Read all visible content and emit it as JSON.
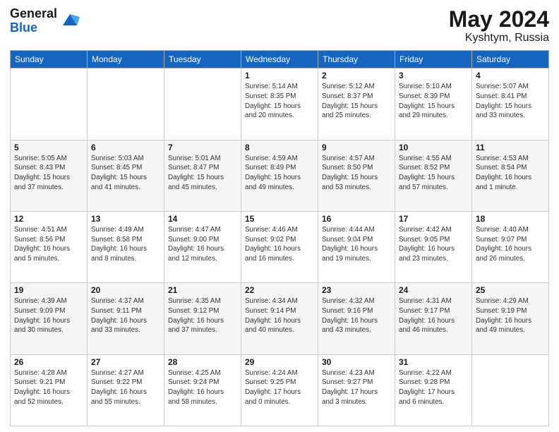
{
  "header": {
    "logo_general": "General",
    "logo_blue": "Blue",
    "title": "May 2024",
    "location": "Kyshtym, Russia"
  },
  "weekdays": [
    "Sunday",
    "Monday",
    "Tuesday",
    "Wednesday",
    "Thursday",
    "Friday",
    "Saturday"
  ],
  "weeks": [
    [
      {
        "day": "",
        "info": ""
      },
      {
        "day": "",
        "info": ""
      },
      {
        "day": "",
        "info": ""
      },
      {
        "day": "1",
        "info": "Sunrise: 5:14 AM\nSunset: 8:35 PM\nDaylight: 15 hours\nand 20 minutes."
      },
      {
        "day": "2",
        "info": "Sunrise: 5:12 AM\nSunset: 8:37 PM\nDaylight: 15 hours\nand 25 minutes."
      },
      {
        "day": "3",
        "info": "Sunrise: 5:10 AM\nSunset: 8:39 PM\nDaylight: 15 hours\nand 29 minutes."
      },
      {
        "day": "4",
        "info": "Sunrise: 5:07 AM\nSunset: 8:41 PM\nDaylight: 15 hours\nand 33 minutes."
      }
    ],
    [
      {
        "day": "5",
        "info": "Sunrise: 5:05 AM\nSunset: 8:43 PM\nDaylight: 15 hours\nand 37 minutes."
      },
      {
        "day": "6",
        "info": "Sunrise: 5:03 AM\nSunset: 8:45 PM\nDaylight: 15 hours\nand 41 minutes."
      },
      {
        "day": "7",
        "info": "Sunrise: 5:01 AM\nSunset: 8:47 PM\nDaylight: 15 hours\nand 45 minutes."
      },
      {
        "day": "8",
        "info": "Sunrise: 4:59 AM\nSunset: 8:49 PM\nDaylight: 15 hours\nand 49 minutes."
      },
      {
        "day": "9",
        "info": "Sunrise: 4:57 AM\nSunset: 8:50 PM\nDaylight: 15 hours\nand 53 minutes."
      },
      {
        "day": "10",
        "info": "Sunrise: 4:55 AM\nSunset: 8:52 PM\nDaylight: 15 hours\nand 57 minutes."
      },
      {
        "day": "11",
        "info": "Sunrise: 4:53 AM\nSunset: 8:54 PM\nDaylight: 16 hours\nand 1 minute."
      }
    ],
    [
      {
        "day": "12",
        "info": "Sunrise: 4:51 AM\nSunset: 8:56 PM\nDaylight: 16 hours\nand 5 minutes."
      },
      {
        "day": "13",
        "info": "Sunrise: 4:49 AM\nSunset: 8:58 PM\nDaylight: 16 hours\nand 8 minutes."
      },
      {
        "day": "14",
        "info": "Sunrise: 4:47 AM\nSunset: 9:00 PM\nDaylight: 16 hours\nand 12 minutes."
      },
      {
        "day": "15",
        "info": "Sunrise: 4:46 AM\nSunset: 9:02 PM\nDaylight: 16 hours\nand 16 minutes."
      },
      {
        "day": "16",
        "info": "Sunrise: 4:44 AM\nSunset: 9:04 PM\nDaylight: 16 hours\nand 19 minutes."
      },
      {
        "day": "17",
        "info": "Sunrise: 4:42 AM\nSunset: 9:05 PM\nDaylight: 16 hours\nand 23 minutes."
      },
      {
        "day": "18",
        "info": "Sunrise: 4:40 AM\nSunset: 9:07 PM\nDaylight: 16 hours\nand 26 minutes."
      }
    ],
    [
      {
        "day": "19",
        "info": "Sunrise: 4:39 AM\nSunset: 9:09 PM\nDaylight: 16 hours\nand 30 minutes."
      },
      {
        "day": "20",
        "info": "Sunrise: 4:37 AM\nSunset: 9:11 PM\nDaylight: 16 hours\nand 33 minutes."
      },
      {
        "day": "21",
        "info": "Sunrise: 4:35 AM\nSunset: 9:12 PM\nDaylight: 16 hours\nand 37 minutes."
      },
      {
        "day": "22",
        "info": "Sunrise: 4:34 AM\nSunset: 9:14 PM\nDaylight: 16 hours\nand 40 minutes."
      },
      {
        "day": "23",
        "info": "Sunrise: 4:32 AM\nSunset: 9:16 PM\nDaylight: 16 hours\nand 43 minutes."
      },
      {
        "day": "24",
        "info": "Sunrise: 4:31 AM\nSunset: 9:17 PM\nDaylight: 16 hours\nand 46 minutes."
      },
      {
        "day": "25",
        "info": "Sunrise: 4:29 AM\nSunset: 9:19 PM\nDaylight: 16 hours\nand 49 minutes."
      }
    ],
    [
      {
        "day": "26",
        "info": "Sunrise: 4:28 AM\nSunset: 9:21 PM\nDaylight: 16 hours\nand 52 minutes."
      },
      {
        "day": "27",
        "info": "Sunrise: 4:27 AM\nSunset: 9:22 PM\nDaylight: 16 hours\nand 55 minutes."
      },
      {
        "day": "28",
        "info": "Sunrise: 4:25 AM\nSunset: 9:24 PM\nDaylight: 16 hours\nand 58 minutes."
      },
      {
        "day": "29",
        "info": "Sunrise: 4:24 AM\nSunset: 9:25 PM\nDaylight: 17 hours\nand 0 minutes."
      },
      {
        "day": "30",
        "info": "Sunrise: 4:23 AM\nSunset: 9:27 PM\nDaylight: 17 hours\nand 3 minutes."
      },
      {
        "day": "31",
        "info": "Sunrise: 4:22 AM\nSunset: 9:28 PM\nDaylight: 17 hours\nand 6 minutes."
      },
      {
        "day": "",
        "info": ""
      }
    ]
  ]
}
